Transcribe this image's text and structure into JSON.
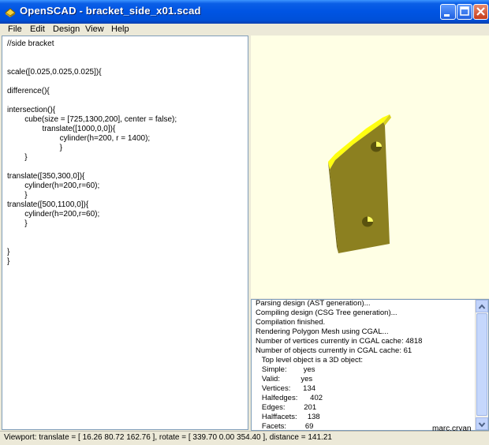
{
  "window": {
    "title": "OpenSCAD - bracket_side_x01.scad",
    "buttons": [
      "minimize-icon",
      "maximize-icon",
      "close-icon"
    ]
  },
  "menubar": {
    "items": [
      "File",
      "Edit",
      "Design",
      "View",
      "Help"
    ]
  },
  "editor": {
    "lines": [
      "//side bracket",
      "",
      "",
      "scale([0.025,0.025,0.025]){",
      "",
      "difference(){",
      "",
      "intersection(){",
      "        cube(size = [725,1300,200], center = false);",
      "                translate([1000,0,0]){",
      "                        cylinder(h=200, r = 1400);",
      "                        }",
      "        }",
      "",
      "translate([350,300,0]){",
      "        cylinder(h=200,r=60);",
      "        }",
      "translate([500,1100,0]){",
      "        cylinder(h=200,r=60);",
      "        }",
      "",
      "",
      "}",
      "}"
    ]
  },
  "viewport": {
    "background": "#ffffe5",
    "model_face_color": "#8c8020",
    "model_top_color": "#ffff10"
  },
  "console": {
    "lines": [
      "Parsing design (AST generation)...",
      "Compiling design (CSG Tree generation)...",
      "Compilation finished.",
      "Rendering Polygon Mesh using CGAL...",
      "Number of vertices currently in CGAL cache: 4818",
      "Number of objects currently in CGAL cache: 61",
      "   Top level object is a 3D object:",
      "   Simple:        yes",
      "   Valid:          yes",
      "   Vertices:      134",
      "   Halfedges:      402",
      "   Edges:         201",
      "   Halffacets:     138",
      "   Facets:         69"
    ]
  },
  "statusbar": {
    "text": "Viewport: translate = [ 16.26 80.72 162.76 ], rotate = [ 339.70 0.00 354.40 ], distance = 141.21"
  },
  "watermark": "marc.cryan"
}
